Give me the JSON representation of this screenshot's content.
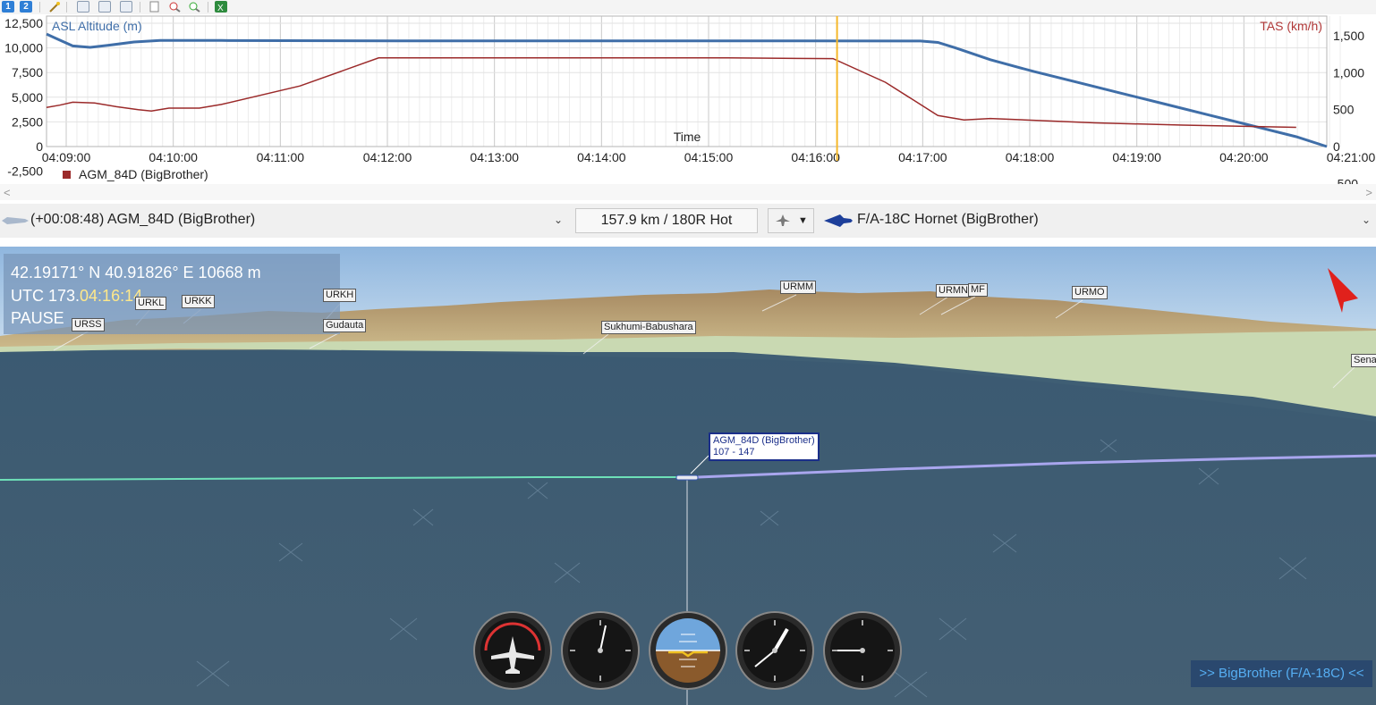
{
  "toolbar": {
    "view1_label": "1",
    "view2_label": "2",
    "tools": [
      "wand-icon",
      "grid-icon",
      "grid-icon",
      "grid-icon",
      "page-icon",
      "zoom-out-icon",
      "zoom-in-icon",
      "export-icon"
    ]
  },
  "chart_data": {
    "type": "line",
    "xlabel": "Time",
    "x_ticks": [
      "04:09:00",
      "04:10:00",
      "04:11:00",
      "04:12:00",
      "04:13:00",
      "04:14:00",
      "04:15:00",
      "04:16:00",
      "04:17:00",
      "04:18:00",
      "04:19:00",
      "04:20:00",
      "04:21:00"
    ],
    "y_left_label": "ASL Altitude (m)",
    "y_left_ticks": [
      "12,500",
      "10,000",
      "7,500",
      "5,000",
      "2,500",
      "0",
      "-2,500"
    ],
    "y_left_range": [
      -2500,
      12500
    ],
    "y_right_label": "TAS (km/h)",
    "y_right_ticks": [
      "1,500",
      "1,000",
      "500",
      "0",
      "-500"
    ],
    "y_right_range": [
      -500,
      1500
    ],
    "cursor_time": "04:16:12",
    "legend": "AGM_84D (BigBrother)",
    "series": [
      {
        "name": "ASL Altitude (m)",
        "color": "#3f6ea8",
        "axis": "left",
        "points": [
          [
            0,
            11400
          ],
          [
            10,
            11000
          ],
          [
            30,
            10200
          ],
          [
            50,
            10050
          ],
          [
            70,
            10250
          ],
          [
            100,
            10600
          ],
          [
            130,
            10750
          ],
          [
            200,
            10750
          ],
          [
            400,
            10720
          ],
          [
            700,
            10720
          ],
          [
            1000,
            10700
          ],
          [
            1020,
            10550
          ],
          [
            1040,
            10000
          ],
          [
            1080,
            8800
          ],
          [
            1130,
            7600
          ],
          [
            1180,
            6500
          ],
          [
            1230,
            5400
          ],
          [
            1280,
            4300
          ],
          [
            1330,
            3200
          ],
          [
            1380,
            2100
          ],
          [
            1430,
            1000
          ],
          [
            1465,
            0
          ]
        ]
      },
      {
        "name": "TAS (km/h)",
        "color": "#9b2a2a",
        "axis": "right",
        "points": [
          [
            0,
            530
          ],
          [
            15,
            560
          ],
          [
            30,
            600
          ],
          [
            55,
            590
          ],
          [
            80,
            540
          ],
          [
            105,
            500
          ],
          [
            120,
            480
          ],
          [
            140,
            520
          ],
          [
            175,
            520
          ],
          [
            200,
            570
          ],
          [
            290,
            820
          ],
          [
            380,
            1200
          ],
          [
            580,
            1200
          ],
          [
            780,
            1200
          ],
          [
            900,
            1190
          ],
          [
            960,
            870
          ],
          [
            1020,
            420
          ],
          [
            1050,
            360
          ],
          [
            1080,
            380
          ],
          [
            1120,
            360
          ],
          [
            1200,
            320
          ],
          [
            1300,
            290
          ],
          [
            1430,
            260
          ]
        ]
      }
    ]
  },
  "scroll": {
    "left_arrow": "<",
    "right_arrow": ">"
  },
  "selector": {
    "left_object": "(+00:08:48) AGM_84D (BigBrother)",
    "distance": "157.9 km / 180R Hot",
    "right_object": "F/A-18C Hornet (BigBrother)"
  },
  "viewport": {
    "coord_line": "42.19171° N  40.91826° E  10668 m",
    "time_prefix": "UTC 173.",
    "time_highlight": "04:16:14",
    "status": "PAUSE",
    "airports": [
      "URKL",
      "URKK",
      "URKH",
      "URSS",
      "Gudauta",
      "Sukhumi-Babushara",
      "URMM",
      "URMN",
      "MF",
      "URMO",
      "Sena"
    ],
    "object_label_name": "AGM_84D (BigBrother)",
    "object_label_info": "107 - 147",
    "follow_label": ">> BigBrother (F/A-18C) <<",
    "colors": {
      "ocean": "#3f5e74",
      "sky": "#a7c6e6",
      "trail_past": "#6ee0b8",
      "trail_future": "#a9a6ee",
      "pointer": "#e0211c"
    }
  }
}
